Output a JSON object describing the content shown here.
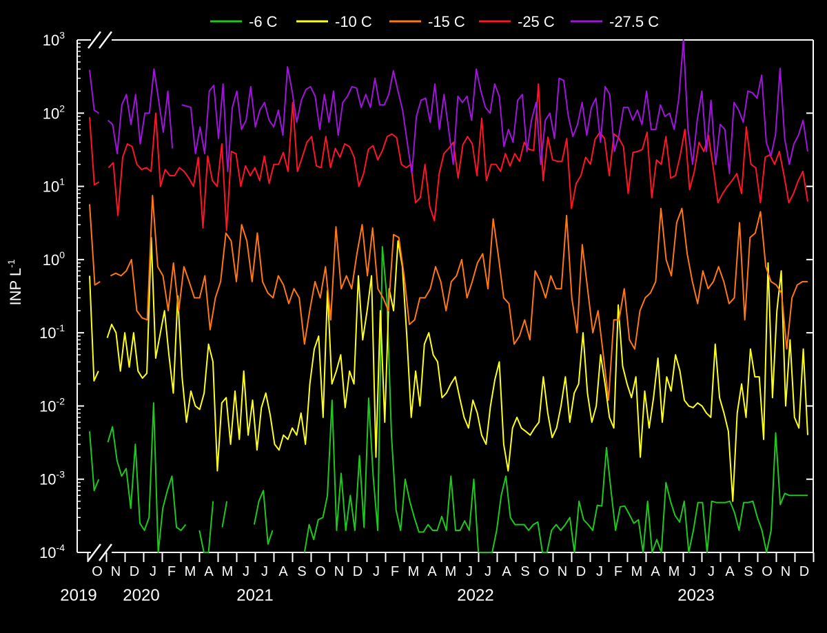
{
  "chart_data": {
    "type": "line",
    "ylabel": "INP L",
    "ylabel_sup": "-1",
    "y_scale": "log",
    "ylim": [
      0.0001,
      1000
    ],
    "y_ticks": [
      {
        "value": 0.0001,
        "base": "10",
        "exp": "-4"
      },
      {
        "value": 0.001,
        "base": "10",
        "exp": "-3"
      },
      {
        "value": 0.01,
        "base": "10",
        "exp": "-2"
      },
      {
        "value": 0.1,
        "base": "10",
        "exp": "-1"
      },
      {
        "value": 1,
        "base": "10",
        "exp": "0"
      },
      {
        "value": 10,
        "base": "10",
        "exp": "1"
      },
      {
        "value": 100,
        "base": "10",
        "exp": "2"
      },
      {
        "value": 1000,
        "base": "10",
        "exp": "3"
      }
    ],
    "grid": false,
    "legend_position": "top",
    "axis_break": true,
    "x_month_labels": [
      "O",
      "N",
      "D",
      "J",
      "F",
      "M",
      "A",
      "M",
      "J",
      "J",
      "A",
      "S",
      "O",
      "N",
      "D",
      "J",
      "F",
      "M",
      "A",
      "M",
      "J",
      "J",
      "A",
      "S",
      "O",
      "N",
      "D",
      "J",
      "F",
      "M",
      "A",
      "M",
      "J",
      "J",
      "A",
      "S",
      "O",
      "N",
      "D"
    ],
    "x_year_labels": [
      "2019",
      "2020",
      "2021",
      "2022",
      "2023"
    ],
    "series": [
      {
        "name": "-6 C",
        "color": "#1ec81e",
        "values": [
          0.0045,
          0.0007,
          0.001,
          null,
          0.0032,
          0.0052,
          0.0018,
          0.0011,
          0.0014,
          0.0004,
          0.003,
          0.00025,
          0.0002,
          0.0003,
          0.011,
          0.0001,
          0.0004,
          0.0007,
          0.0011,
          0.00022,
          0.0002,
          0.00024,
          null,
          null,
          0.0002,
          0.0001,
          0.0001,
          0.0005,
          null,
          0.00022,
          0.0005,
          null,
          null,
          null,
          null,
          null,
          0.00024,
          0.0005,
          0.0007,
          0.00013,
          0.0002,
          null,
          null,
          null,
          0.0002,
          null,
          null,
          0.0001,
          0.00024,
          0.00015,
          0.00028,
          0.0003,
          0.0006,
          0.012,
          0.0002,
          0.0012,
          0.0002,
          0.0006,
          0.0002,
          0.0021,
          0.00022,
          0.0128,
          0.0011,
          0.0002,
          1.5,
          0.3,
          0.004,
          0.00038,
          0.0002,
          0.001,
          0.0005,
          0.0003,
          0.00019,
          0.00019,
          0.00024,
          0.0002,
          0.0002,
          0.00031,
          0.0002,
          0.0011,
          0.0002,
          0.0002,
          0.00027,
          0.0002,
          0.001,
          0.0001,
          0.0001,
          0.0001,
          0.0001,
          0.0002,
          0.0006,
          0.0011,
          0.0003,
          0.00024,
          0.00024,
          0.00024,
          0.0002,
          0.00024,
          0.00026,
          0.0001,
          0.0001,
          0.0002,
          0.00024,
          0.0002,
          0.00024,
          0.0003,
          0.0001,
          0.0005,
          0.00028,
          0.00024,
          0.0002,
          0.00044,
          0.00043,
          0.0027,
          0.0007,
          0.0002,
          0.00042,
          0.00043,
          0.00033,
          0.00025,
          0.00028,
          0.0001,
          0.0005,
          0.0001,
          0.00015,
          0.0001,
          0.0009,
          0.0005,
          0.00032,
          0.00026,
          0.0005,
          0.0001,
          0.0002,
          0.00048,
          0.00048,
          0.0001,
          0.0005,
          0.00048,
          0.00048,
          0.00048,
          0.0005,
          0.00035,
          0.0002,
          0.00048,
          0.00048,
          0.0005,
          0.0003,
          0.0002,
          0.0001,
          0.0002,
          0.0043,
          0.00045,
          0.00064,
          0.0006,
          0.0006,
          0.0006,
          0.0006,
          0.0006
        ]
      },
      {
        "name": "-10 C",
        "color": "#ffff1e",
        "values": [
          0.6,
          0.022,
          0.03,
          null,
          0.085,
          0.13,
          0.1,
          0.03,
          0.1,
          0.034,
          0.1,
          0.03,
          0.024,
          0.028,
          2.0,
          0.045,
          0.095,
          0.2,
          0.05,
          0.015,
          0.32,
          0.025,
          0.006,
          0.016,
          0.01,
          0.009,
          0.015,
          0.07,
          0.04,
          0.0013,
          0.011,
          0.013,
          0.003,
          0.016,
          0.0035,
          0.03,
          0.004,
          0.012,
          0.0025,
          0.0095,
          0.015,
          0.0075,
          0.003,
          0.0025,
          0.004,
          0.0035,
          0.005,
          0.004,
          0.008,
          0.003,
          0.02,
          0.06,
          0.09,
          0.007,
          0.38,
          0.02,
          0.03,
          0.05,
          0.0095,
          0.03,
          0.02,
          0.6,
          0.08,
          0.2,
          0.6,
          0.002,
          0.2,
          0.006,
          0.4,
          0.2,
          1.8,
          0.8,
          0.09,
          0.007,
          0.03,
          0.01,
          0.07,
          0.1,
          0.05,
          0.04,
          0.013,
          0.015,
          0.02,
          0.025,
          0.013,
          0.007,
          0.005,
          0.012,
          0.008,
          0.004,
          0.003,
          0.01,
          0.023,
          0.04,
          0.003,
          0.0013,
          0.005,
          0.007,
          0.005,
          0.0045,
          0.004,
          0.005,
          0.006,
          0.025,
          0.008,
          0.0037,
          0.005,
          0.01,
          0.025,
          0.006,
          0.015,
          0.02,
          0.1,
          0.015,
          0.006,
          0.01,
          0.05,
          0.02,
          0.007,
          0.005,
          0.24,
          0.035,
          0.02,
          0.013,
          0.025,
          0.002,
          0.016,
          0.005,
          0.013,
          0.045,
          0.006,
          0.025,
          0.016,
          0.05,
          0.03,
          0.012,
          0.01,
          0.0095,
          0.011,
          0.01,
          0.008,
          0.007,
          0.07,
          0.013,
          0.008,
          0.0045,
          0.0005,
          0.008,
          0.02,
          0.007,
          0.06,
          0.025,
          0.025,
          0.0035,
          0.9,
          0.013,
          0.2,
          0.7,
          0.01,
          0.08,
          0.007,
          0.005,
          0.06,
          0.004
        ]
      },
      {
        "name": "-15 C",
        "color": "#ff7814",
        "values": [
          5.7,
          0.45,
          0.5,
          null,
          0.6,
          0.65,
          0.6,
          0.7,
          1.0,
          0.2,
          0.16,
          0.15,
          7.5,
          0.8,
          0.6,
          0.2,
          0.9,
          0.2,
          0.8,
          0.5,
          0.3,
          0.3,
          0.6,
          0.11,
          0.3,
          0.5,
          2.3,
          1.8,
          0.5,
          3.0,
          1.8,
          0.5,
          2.3,
          0.5,
          0.35,
          0.3,
          0.6,
          0.45,
          0.25,
          0.4,
          0.3,
          0.07,
          0.2,
          0.5,
          0.3,
          0.8,
          0.15,
          2.8,
          0.4,
          0.6,
          0.4,
          1.2,
          3.0,
          0.6,
          2.7,
          0.4,
          0.3,
          0.2,
          2.2,
          2.0,
          0.6,
          0.13,
          0.15,
          0.3,
          0.3,
          0.4,
          0.8,
          0.5,
          0.2,
          0.5,
          0.6,
          1.0,
          0.3,
          0.5,
          0.9,
          1.2,
          0.4,
          3.6,
          1.1,
          0.3,
          0.25,
          0.07,
          0.09,
          0.15,
          0.08,
          0.7,
          0.5,
          0.3,
          0.6,
          0.4,
          0.4,
          4.0,
          0.3,
          0.1,
          1.6,
          0.4,
          0.1,
          0.2,
          0.05,
          0.012,
          0.15,
          0.15,
          0.4,
          0.08,
          0.06,
          0.2,
          0.3,
          0.35,
          0.5,
          5.0,
          1.0,
          0.6,
          3.2,
          5.0,
          1.2,
          0.5,
          0.25,
          0.7,
          0.4,
          0.5,
          0.8,
          0.5,
          0.25,
          0.3,
          3.2,
          0.15,
          2.0,
          2.3,
          4.5,
          0.8,
          0.5,
          0.45,
          0.35,
          0.06,
          0.3,
          0.45,
          0.5,
          0.5
        ]
      },
      {
        "name": "-25 C",
        "color": "#ff1428",
        "values": [
          88,
          10.5,
          11.5,
          null,
          18,
          21,
          4,
          25,
          38,
          35,
          20,
          17,
          18,
          16,
          100,
          10,
          17,
          14,
          14,
          18,
          16,
          13,
          10,
          25,
          2.7,
          26,
          12,
          10,
          38,
          2.5,
          30,
          28,
          10,
          19,
          14,
          18,
          12,
          26,
          11,
          20,
          20,
          29,
          16,
          140,
          16,
          25,
          40,
          48,
          19,
          18,
          48,
          18,
          33,
          25,
          38,
          35,
          25,
          10,
          15,
          32,
          36,
          23,
          31,
          48,
          52,
          46,
          20,
          18,
          20,
          6,
          7,
          20,
          5.3,
          3.4,
          15,
          28,
          33,
          40,
          13,
          37,
          48,
          38,
          14,
          85,
          12,
          20,
          20,
          16,
          28,
          19,
          28,
          22,
          40,
          32,
          31,
          250,
          12,
          47,
          23,
          22,
          22,
          45,
          5.0,
          11,
          14,
          25,
          20,
          44,
          55,
          45,
          14,
          52,
          46,
          35,
          8,
          29,
          30,
          32,
          55,
          7.0,
          23,
          20,
          48,
          13,
          14,
          26,
          60,
          9,
          16,
          40,
          30,
          50,
          18,
          6,
          8,
          10,
          12,
          15,
          8,
          65,
          20,
          18,
          6.0,
          25,
          27,
          20,
          30,
          14,
          6,
          8,
          12,
          16,
          6.2
        ]
      },
      {
        "name": "-27.5 C",
        "color": "#a014dc",
        "values": [
          390,
          110,
          100,
          null,
          80,
          70,
          28,
          130,
          180,
          70,
          180,
          38,
          100,
          100,
          400,
          150,
          55,
          200,
          33,
          null,
          130,
          125,
          120,
          28,
          65,
          28,
          200,
          240,
          45,
          250,
          16,
          120,
          200,
          60,
          80,
          230,
          65,
          110,
          140,
          80,
          65,
          110,
          50,
          430,
          200,
          75,
          150,
          210,
          230,
          170,
          60,
          180,
          75,
          200,
          50,
          140,
          170,
          230,
          220,
          120,
          180,
          120,
          300,
          130,
          130,
          180,
          380,
          200,
          110,
          40,
          15,
          90,
          150,
          160,
          75,
          250,
          60,
          180,
          60,
          20,
          170,
          140,
          170,
          80,
          400,
          200,
          120,
          100,
          250,
          170,
          35,
          60,
          40,
          150,
          180,
          30,
          80,
          140,
          20,
          80,
          100,
          45,
          300,
          280,
          90,
          48,
          70,
          140,
          50,
          120,
          160,
          40,
          230,
          180,
          30,
          50,
          120,
          120,
          80,
          110,
          70,
          200,
          60,
          60,
          130,
          90,
          100,
          60,
          160,
          1000,
          60,
          20,
          80,
          200,
          30,
          150,
          20,
          70,
          60,
          15,
          140,
          110,
          75,
          200,
          190,
          160,
          330,
          40,
          26,
          50,
          410,
          45,
          20,
          38,
          50,
          80,
          30
        ]
      }
    ]
  }
}
